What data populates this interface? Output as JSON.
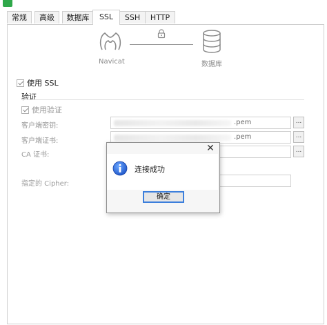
{
  "window": {
    "title": ""
  },
  "tabs": [
    {
      "label": "常规"
    },
    {
      "label": "高级"
    },
    {
      "label": "数据库"
    },
    {
      "label": "SSL",
      "active": true
    },
    {
      "label": "SSH"
    },
    {
      "label": "HTTP"
    }
  ],
  "diagram": {
    "left_label": "Navicat",
    "right_label": "数据库"
  },
  "ssl": {
    "use_ssl_label": "使用 SSL",
    "use_ssl_checked": true,
    "auth_section_title": "验证",
    "use_auth_label": "使用验证",
    "use_auth_checked": true,
    "client_key_label": "客户端密钥:",
    "client_key_value": ".pem",
    "client_cert_label": "客户端证书:",
    "client_cert_value": ".pem",
    "ca_cert_label": "CA 证书:",
    "ca_cert_value": "",
    "cipher_label": "指定的 Cipher:",
    "cipher_value": "",
    "browse_label": "..."
  },
  "dialog": {
    "message": "连接成功",
    "ok_label": "确定",
    "close_symbol": "✕"
  },
  "colors": {
    "accent": "#3c7fdc",
    "info_icon": "#1e55c8"
  }
}
